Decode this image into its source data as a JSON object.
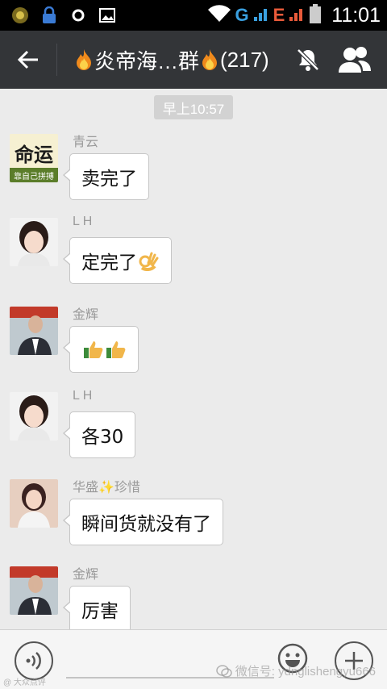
{
  "status_bar": {
    "network_letter_1": "G",
    "network_letter_2": "E",
    "time": "11:01"
  },
  "header": {
    "title_prefix": "炎帝海…群",
    "title_suffix": "(217)",
    "title_emoji": "flame-icon"
  },
  "chat": {
    "timestamp": "早上10:57",
    "messages": [
      {
        "sender": "青云",
        "text": "卖完了",
        "avatar": "avatar-fate-calligraphy",
        "emoji": ""
      },
      {
        "sender": "L H",
        "text": "定完了",
        "avatar": "avatar-girl",
        "emoji": "ok-hand-icon"
      },
      {
        "sender": "金辉",
        "text": "",
        "avatar": "avatar-man-suit",
        "emoji": "thumbs-up-icon x2"
      },
      {
        "sender": "L H",
        "text": "各30",
        "avatar": "avatar-girl",
        "emoji": ""
      },
      {
        "sender": "华盛✨珍惜",
        "text": "瞬间货就没有了",
        "avatar": "avatar-woman",
        "emoji": ""
      },
      {
        "sender": "金辉",
        "text": "厉害",
        "avatar": "avatar-man-suit",
        "emoji": ""
      }
    ]
  },
  "avatar_texts": {
    "fate_big": "命运",
    "fate_small": "靠自己拼搏"
  },
  "input_bar": {
    "watermark": "微信号: ydnglishengyu666",
    "watermark_corner": "@ 大众点评"
  },
  "colors": {
    "header_bg": "#333538",
    "chat_bg": "#ebebeb",
    "bubble_bg": "#ffffff",
    "sender_text": "#9a9a9a"
  }
}
